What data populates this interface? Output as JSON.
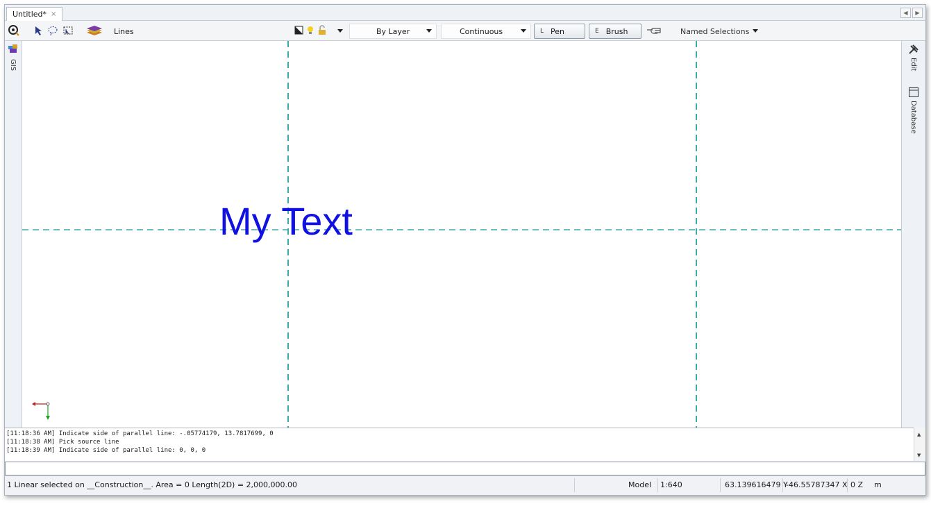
{
  "document_tab": {
    "title": "Untitled*",
    "close": "×"
  },
  "toolbar": {
    "layer_name": "Lines",
    "line_color": "By Layer",
    "line_style": "Continuous",
    "pen": {
      "key": "L",
      "label": "Pen"
    },
    "brush": {
      "key": "E",
      "label": "Brush"
    },
    "named_selections": "Named Selections"
  },
  "left_panel": {
    "gis_label": "GIS"
  },
  "right_panel": {
    "edit_label": "Edit",
    "database_label": "Database"
  },
  "canvas": {
    "text_object": "My Text",
    "construction_color": "#3aaaa8",
    "text_color": "#1010e0"
  },
  "command_log": [
    "[11:18:36 AM] Indicate side of parallel line: -.05774179, 13.7817699, 0",
    "[11:18:38 AM] Pick source line",
    "[11:18:39 AM] Indicate side of parallel line: 0, 0, 0"
  ],
  "command_input": "",
  "status_bar": {
    "message": "1 Linear selected on __Construction__.  Area = 0   Length(2D) = 2,000,000.00",
    "space": "Model",
    "scale": "1:640",
    "y_value": "63.139616479",
    "y_label": "Y",
    "x_value": "-46.55787347",
    "x_label": "X",
    "z_value": "0",
    "z_label": "Z",
    "units": "m"
  }
}
